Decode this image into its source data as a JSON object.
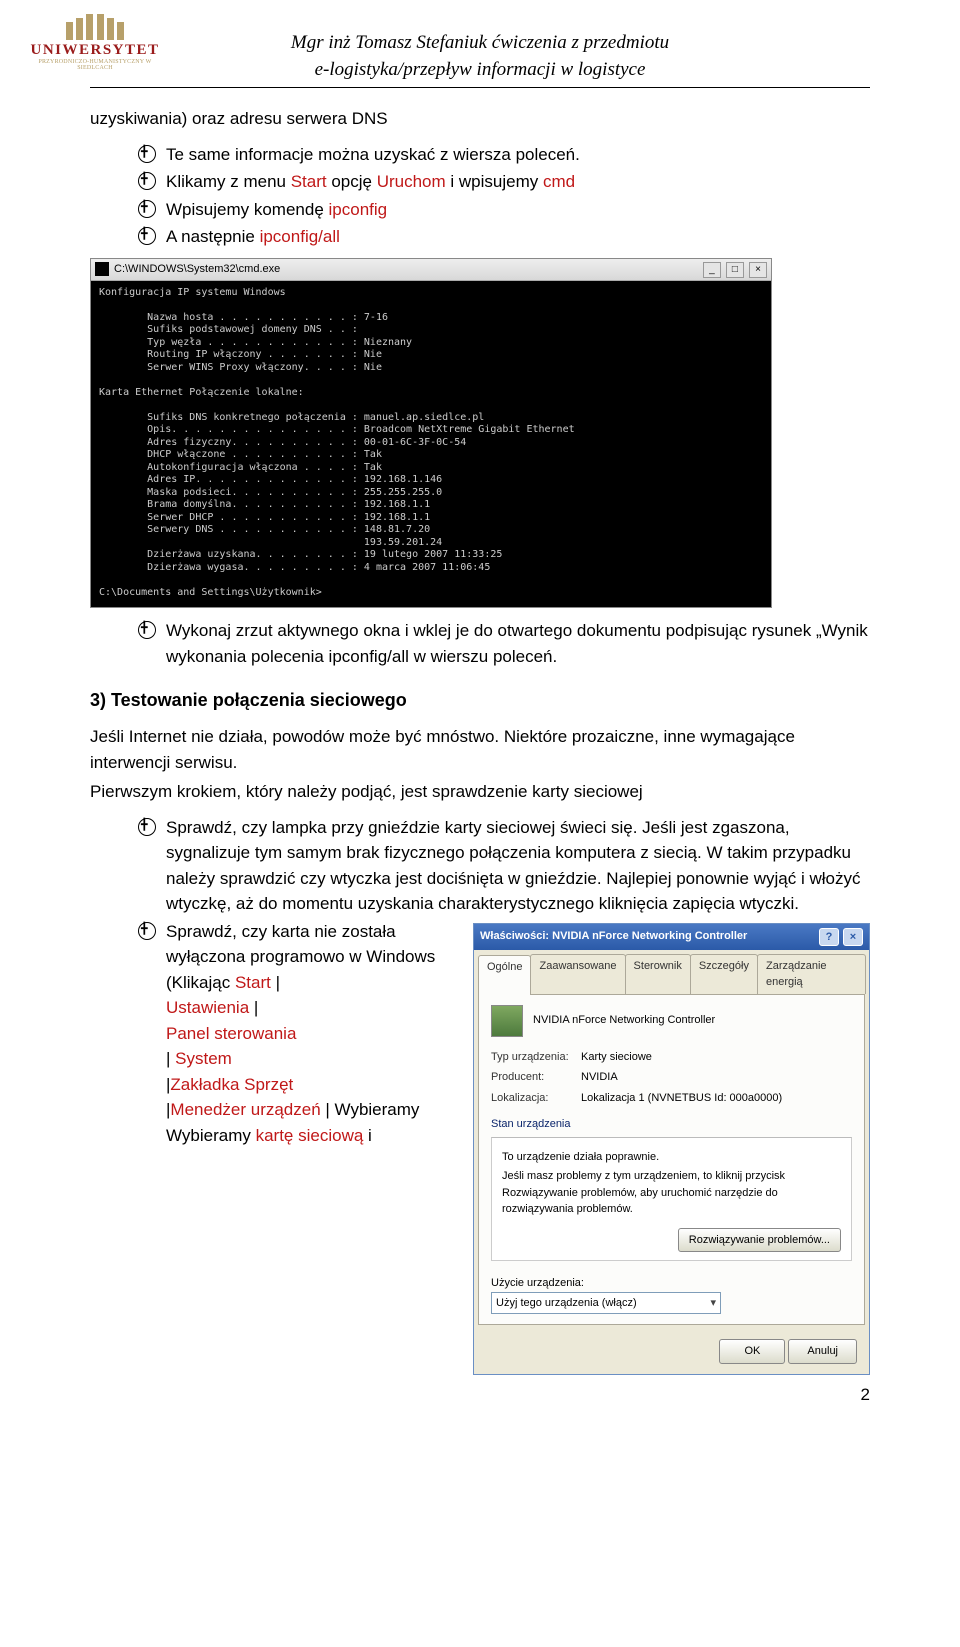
{
  "header": {
    "line1": "Mgr inż Tomasz Stefaniuk ćwiczenia z przedmiotu",
    "line2": "e-logistyka/przepływ informacji w logistyce",
    "logo_word": "UNIWERSYTET",
    "logo_sub": "PRZYRODNICZO-HUMANISTYCZNY W SIEDLCACH"
  },
  "intro_line": "uzyskiwania) oraz adresu serwera DNS",
  "bullets_a": {
    "b1": "Te same informacje można uzyskać z wiersza poleceń.",
    "b2_pre": "Klikamy z menu ",
    "b2_red1": "Start",
    "b2_mid": " opcję ",
    "b2_red2": "Uruchom",
    "b2_post": " i wpisujemy ",
    "b2_red3": "cmd",
    "b3_pre": "Wpisujemy komendę ",
    "b3_red": "ipconfig",
    "b4_pre": "A następnie ",
    "b4_red": "ipconfig/all"
  },
  "cmd": {
    "title": "C:\\WINDOWS\\System32\\cmd.exe",
    "body": "Konfiguracja IP systemu Windows\n\n        Nazwa hosta . . . . . . . . . . . : 7-16\n        Sufiks podstawowej domeny DNS . . :\n        Typ węzła . . . . . . . . . . . . : Nieznany\n        Routing IP włączony . . . . . . . : Nie\n        Serwer WINS Proxy włączony. . . . : Nie\n\nKarta Ethernet Połączenie lokalne:\n\n        Sufiks DNS konkretnego połączenia : manuel.ap.siedlce.pl\n        Opis. . . . . . . . . . . . . . . : Broadcom NetXtreme Gigabit Ethernet\n        Adres fizyczny. . . . . . . . . . : 00-01-6C-3F-0C-54\n        DHCP włączone . . . . . . . . . . : Tak\n        Autokonfiguracja włączona . . . . : Tak\n        Adres IP. . . . . . . . . . . . . : 192.168.1.146\n        Maska podsieci. . . . . . . . . . : 255.255.255.0\n        Brama domyślna. . . . . . . . . . : 192.168.1.1\n        Serwer DHCP . . . . . . . . . . . : 192.168.1.1\n        Serwery DNS . . . . . . . . . . . : 148.81.7.20\n                                            193.59.201.24\n        Dzierżawa uzyskana. . . . . . . . : 19 lutego 2007 11:33:25\n        Dzierżawa wygasa. . . . . . . . . : 4 marca 2007 11:06:45\n\nC:\\Documents and Settings\\Użytkownik>"
  },
  "bullets_b": {
    "b1": "Wykonaj zrzut aktywnego okna i wklej je do otwartego dokumentu podpisując rysunek „Wynik wykonania polecenia ipconfig/all w wierszu poleceń."
  },
  "section3": {
    "title": "3)  Testowanie połączenia sieciowego",
    "p1": "Jeśli Internet nie działa, powodów może być mnóstwo. Niektóre prozaiczne, inne wymagające interwencji serwisu.",
    "p2": "Pierwszym krokiem, który należy podjąć, jest sprawdzenie karty sieciowej",
    "c1": "Sprawdź, czy lampka przy gnieździe karty sieciowej świeci się. Jeśli jest zgaszona, sygnalizuje tym samym brak fizycznego połączenia komputera z siecią. W takim przypadku należy sprawdzić czy wtyczka jest dociśnięta w gnieździe. Najlepiej ponownie wyjąć i włożyć wtyczkę, aż do momentu uzyskania charakterystycznego kliknięcia zapięcia wtyczki.",
    "c2_pre": "Sprawdź, czy karta nie została wyłączona programowo w Windows",
    "c2_par_pre": "(Klikając ",
    "c2_red1": "Start",
    "c2_sep1": " | ",
    "c2_red2": "Ustawienia",
    "c2_sep2": " | ",
    "c2_red3": "Panel sterowania",
    "c2_sep3": " | ",
    "c2_red4": "System",
    "c2_sep4": " |",
    "c2_red5": "Zakładka Sprzęt",
    "c2_sep5": " |",
    "c2_red6": "Menedżer urządzeń",
    "c2_sep6": " | Wybieramy ",
    "c2_red7": "kartę sieciową",
    "c2_post": " i"
  },
  "dialog": {
    "title": "Właściwości: NVIDIA nForce Networking Controller",
    "tabs": {
      "t1": "Ogólne",
      "t2": "Zaawansowane",
      "t3": "Sterownik",
      "t4": "Szczegóły",
      "t5": "Zarządzanie energią"
    },
    "device_name": "NVIDIA nForce Networking Controller",
    "rows": {
      "type_l": "Typ urządzenia:",
      "type_v": "Karty sieciowe",
      "prod_l": "Producent:",
      "prod_v": "NVIDIA",
      "loc_l": "Lokalizacja:",
      "loc_v": "Lokalizacja 1 (NVNETBUS Id: 000a0000)"
    },
    "status_group": "Stan urządzenia",
    "status_ok": "To urządzenie działa poprawnie.",
    "status_help": "Jeśli masz problemy z tym urządzeniem, to kliknij przycisk Rozwiązywanie problemów, aby uruchomić narzędzie do rozwiązywania problemów.",
    "troubleshoot_btn": "Rozwiązywanie problemów...",
    "usage_label": "Użycie urządzenia:",
    "usage_value": "Użyj tego urządzenia (włącz)",
    "ok": "OK",
    "cancel": "Anuluj"
  },
  "pagenum": "2"
}
